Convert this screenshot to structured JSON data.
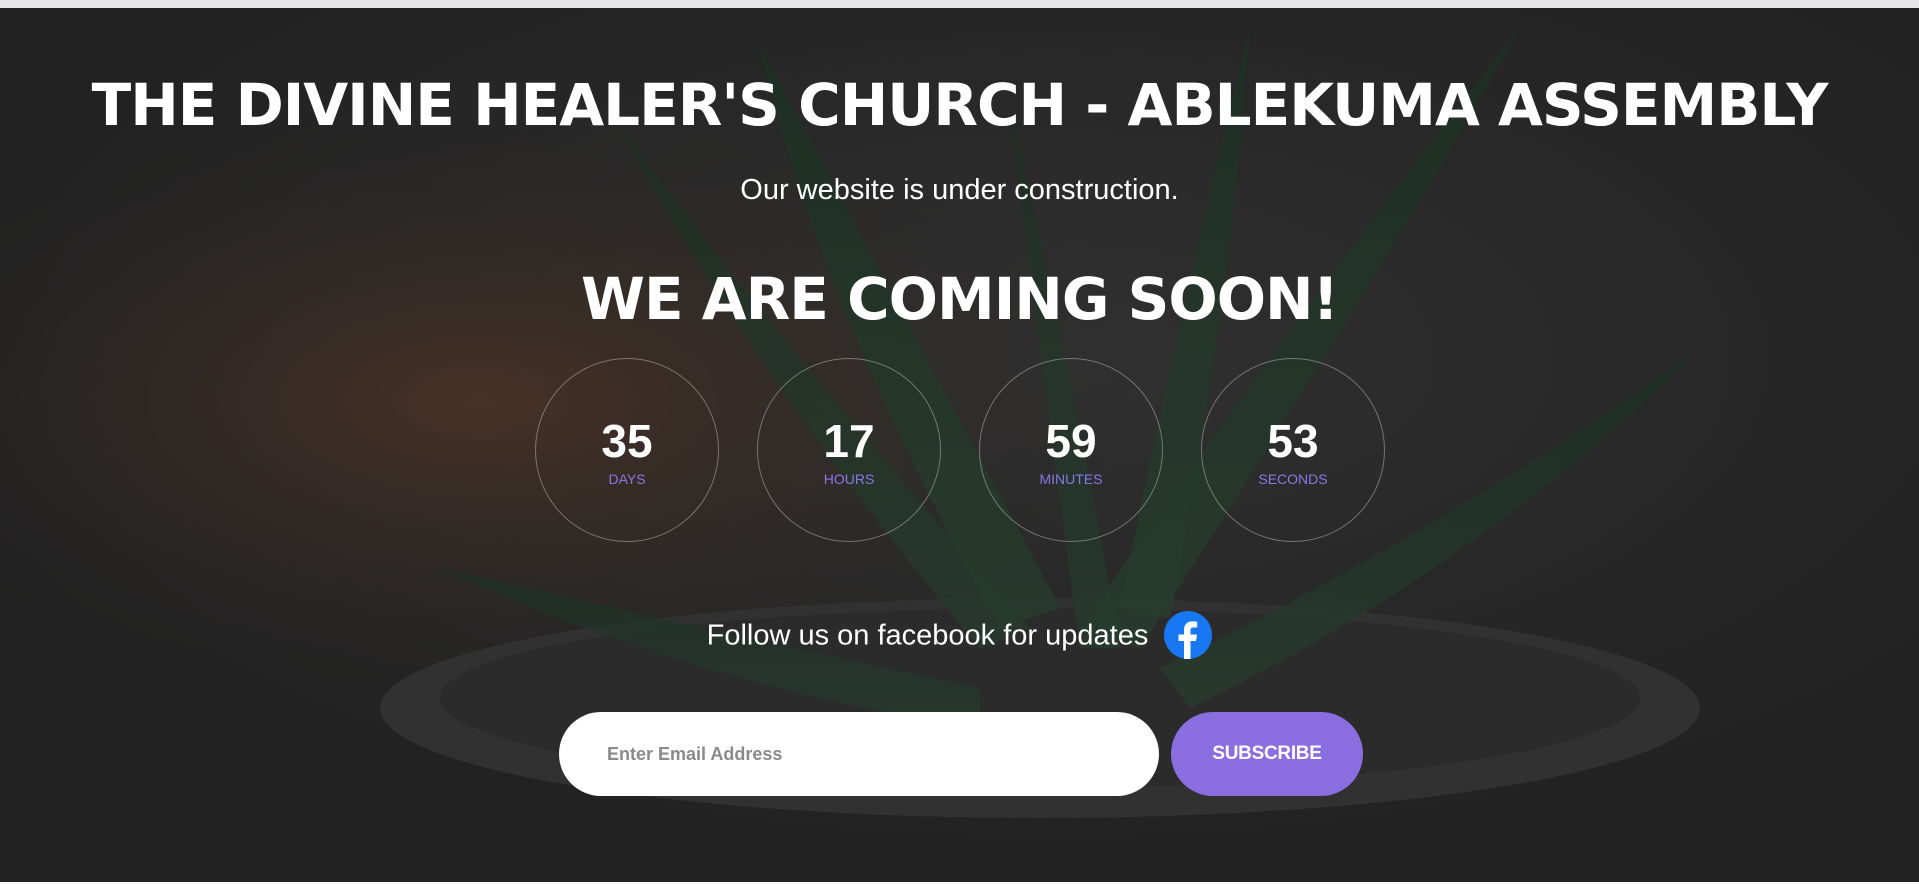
{
  "header": {
    "title": "THE DIVINE HEALER'S CHURCH - ABLEKUMA ASSEMBLY",
    "subtitle": "Our website is under construction.",
    "headline": "WE ARE COMING SOON!"
  },
  "countdown": [
    {
      "value": "35",
      "unit": "DAYS"
    },
    {
      "value": "17",
      "unit": "HOURS"
    },
    {
      "value": "59",
      "unit": "MINUTES"
    },
    {
      "value": "53",
      "unit": "SECONDS"
    }
  ],
  "social": {
    "text": "Follow us on facebook for updates",
    "icon": "facebook-icon",
    "color": "#1877f2"
  },
  "subscribe": {
    "email_placeholder": "Enter Email Address",
    "button_label": "SUBSCRIBE"
  },
  "colors": {
    "accent": "#8a6ee0",
    "unit_label": "#8b76e6",
    "text": "#ffffff"
  }
}
